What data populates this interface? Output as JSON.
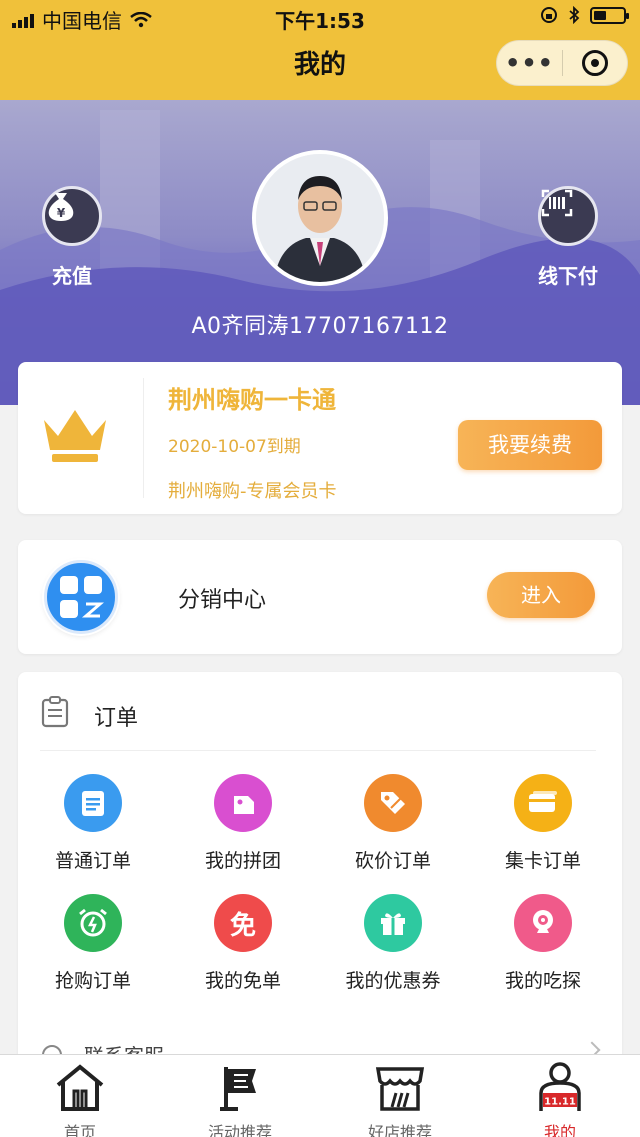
{
  "status_bar": {
    "carrier": "中国电信",
    "time": "下午1:53"
  },
  "nav": {
    "title": "我的",
    "more_label": "•••"
  },
  "banner": {
    "recharge_label": "充值",
    "offline_pay_label": "线下付",
    "username": "A0齐同涛17707167112",
    "yen_symbol": "¥"
  },
  "member_card": {
    "title": "荆州嗨购一卡通",
    "expire": "2020-10-07到期",
    "description": "荆州嗨购-专属会员卡",
    "renew_label": "我要续费"
  },
  "distribution": {
    "label": "分销中心",
    "enter_label": "进入"
  },
  "orders": {
    "title": "订单",
    "items": [
      {
        "label": "普通订单",
        "icon": "clipboard-icon",
        "color": "#3a9bef"
      },
      {
        "label": "我的拼团",
        "icon": "tag-icon",
        "color": "#d94fd0"
      },
      {
        "label": "砍价订单",
        "icon": "price-tag-icon",
        "color": "#f08a2e"
      },
      {
        "label": "集卡订单",
        "icon": "card-icon",
        "color": "#f5b116"
      },
      {
        "label": "抢购订单",
        "icon": "alarm-clock-icon",
        "color": "#2fb45a"
      },
      {
        "label": "我的免单",
        "icon": "free-icon",
        "color": "#ef4b4b",
        "glyph": "免"
      },
      {
        "label": "我的优惠券",
        "icon": "gift-icon",
        "color": "#2ec9a0"
      },
      {
        "label": "我的吃探",
        "icon": "camera-icon",
        "color": "#f05a8a"
      }
    ],
    "service_label": "联系客服"
  },
  "tabbar": {
    "tabs": [
      {
        "label": "首页"
      },
      {
        "label": "活动推荐"
      },
      {
        "label": "好店推荐"
      },
      {
        "label": "我的",
        "badge": "11.11"
      }
    ]
  }
}
